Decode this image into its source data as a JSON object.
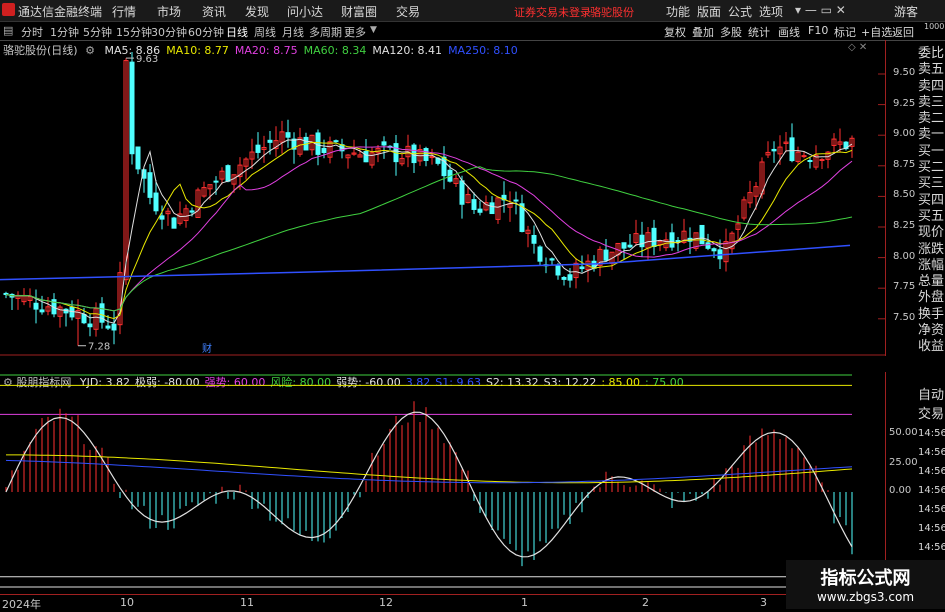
{
  "app": {
    "title": "通达信金融终端"
  },
  "menus": [
    "行情",
    "市场",
    "资讯",
    "发现",
    "问小达",
    "财富圈",
    "交易"
  ],
  "notice": {
    "text": "证券交易未登录",
    "stock": "骆驼股份"
  },
  "right_menus": [
    "功能",
    "版面",
    "公式",
    "选项"
  ],
  "user": "游客",
  "periods": [
    "分时",
    "1分钟",
    "5分钟",
    "15分钟",
    "30分钟",
    "60分钟",
    "日线",
    "周线",
    "月线",
    "多周期",
    "更多"
  ],
  "active_period": "日线",
  "toolbar": [
    "复权",
    "叠加",
    "多股",
    "统计",
    "画线",
    "F10",
    "标记",
    "+自选",
    "返回"
  ],
  "main": {
    "title": "骆驼股份(日线)",
    "ma_labels": [
      {
        "text": "MA5: 8.86",
        "color": "#e0e0e0"
      },
      {
        "text": "MA10: 8.77",
        "color": "#e8e800"
      },
      {
        "text": "MA20: 8.75",
        "color": "#e040e0"
      },
      {
        "text": "MA60: 8.34",
        "color": "#40d040"
      },
      {
        "text": "MA120: 8.41",
        "color": "#e0e0e0"
      },
      {
        "text": "MA250: 8.10",
        "color": "#3050ff"
      }
    ],
    "high_label": "9.63",
    "low_label": "7.28",
    "cai": "财",
    "y_ticks": [
      "9.50",
      "9.25",
      "9.00",
      "8.75",
      "8.50",
      "8.25",
      "8.00",
      "7.75",
      "7.50"
    ]
  },
  "sub": {
    "name": "股朋指标网",
    "labels": [
      {
        "text": "YJD: 3.82",
        "color": "#e0e0e0"
      },
      {
        "text": "极弱: -80.00",
        "color": "#e0e0e0"
      },
      {
        "text": "强势: 60.00",
        "color": "#e040e0"
      },
      {
        "text": "风险: 80.00",
        "color": "#40d040"
      },
      {
        "text": "弱势: -60.00",
        "color": "#e0e0e0"
      },
      {
        "text": "3.82",
        "color": "#3050ff"
      },
      {
        "text": "S1: 9.63",
        "color": "#3050ff"
      },
      {
        "text": "S2: 13.32",
        "color": "#e0e0e0"
      },
      {
        "text": "S3: 12.22",
        "color": "#e0e0e0"
      },
      {
        "text": ": 85.00",
        "color": "#e8e800"
      },
      {
        "text": ": 75.00",
        "color": "#40d040"
      }
    ],
    "y_ticks": [
      "50.00",
      "25.00",
      "0.00"
    ]
  },
  "x_labels": [
    "2024年",
    "10",
    "11",
    "12",
    "1",
    "2",
    "3"
  ],
  "side_main": [
    "委比",
    "卖五",
    "卖四",
    "卖三",
    "卖二",
    "卖一",
    "买一",
    "买二",
    "买三",
    "买四",
    "买五",
    "现价",
    "涨跌",
    "涨幅",
    "总量",
    "外盘",
    "换手",
    "净资",
    "收益"
  ],
  "side_sub": [
    "自动",
    "交易",
    "14:56",
    "14:56",
    "14:56",
    "14:56",
    "14:56",
    "14:56",
    "14:56",
    "14:56"
  ],
  "side_top": "1000",
  "watermark": {
    "title": "指标公式网",
    "url": "www.zbgs3.com"
  },
  "colors": {
    "up": "#ff3030",
    "down": "#50ffff",
    "ma5": "#e0e0e0",
    "ma10": "#e8e800",
    "ma20": "#e040e0",
    "ma60": "#40d040",
    "ma250": "#3050ff"
  }
}
